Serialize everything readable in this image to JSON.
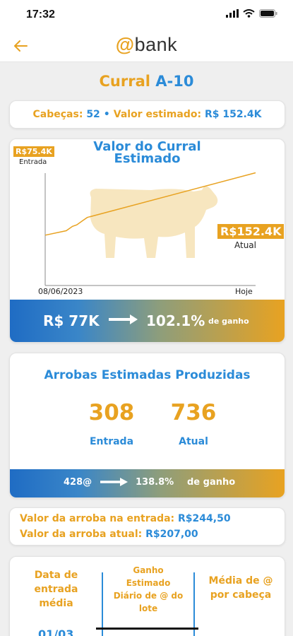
{
  "status_bar": {
    "time": "17:32"
  },
  "header": {
    "logo_at": "@",
    "logo_text": "bank"
  },
  "page_title": {
    "prefix": "Curral",
    "code": "A-10"
  },
  "summary": {
    "heads_label": "Cabeças:",
    "heads_value": "52",
    "separator": "•",
    "value_label": "Valor estimado:",
    "value_value": "R$ 152.4K"
  },
  "value_chart": {
    "title_line1": "Valor do Curral",
    "title_line2": "Estimado",
    "entry_tag": "R$75.4K",
    "entry_label": "Entrada",
    "current_tag": "R$152.4K",
    "current_label": "Atual",
    "x_start": "08/06/2023",
    "x_end": "Hoje",
    "gain_from": "R$ 77K",
    "gain_pct": "102.1%",
    "gain_suffix": "de ganho"
  },
  "chart_data": {
    "type": "line",
    "x": [
      "08/06/2023",
      "Hoje"
    ],
    "series": [
      {
        "values": [
          75.4,
          152.4
        ]
      }
    ],
    "xlabel": "",
    "ylabel": "",
    "grid": false
  },
  "arrobas": {
    "title": "Arrobas Estimadas Produzidas",
    "entry_value": "308",
    "entry_label": "Entrada",
    "current_value": "736",
    "current_label": "Atual",
    "gain_from": "428@",
    "gain_pct": "138.8%",
    "gain_suffix": "de ganho"
  },
  "prices": {
    "entry_label": "Valor da arroba na entrada:",
    "entry_value": "R$244,50",
    "current_label": "Valor da arroba atual:",
    "current_value": "R$207,00"
  },
  "table": {
    "col1_line1": "Data de",
    "col1_line2": "entrada",
    "col1_line3": "média",
    "col2_line1": "Ganho",
    "col2_line2": "Estimado",
    "col2_line3": "Diário de @ do",
    "col2_line4": "lote",
    "col3_line1": "Média de @",
    "col3_line2": "por cabeça",
    "row_date": "01/03"
  },
  "colors": {
    "accent": "#e8a221",
    "primary": "#2b8bd8"
  }
}
